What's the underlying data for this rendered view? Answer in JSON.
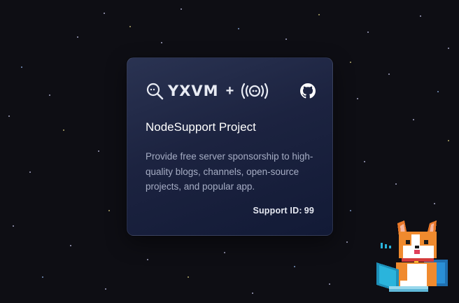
{
  "card": {
    "brand_text": "YXVM",
    "plus": "+",
    "title": "NodeSupport Project",
    "description": "Provide free server sponsorship to high-quality blogs, channels, open-source projects, and popular app.",
    "support_label": "Support ID:",
    "support_id": "99"
  },
  "icons": [
    "magnifier-logo-icon",
    "radio-broadcast-icon",
    "github-icon",
    "corgi-mascot"
  ],
  "colors": {
    "background": "#0e0e14",
    "card_top": "#2a3352",
    "card_bottom": "#121a36",
    "title": "#ffffff",
    "description": "#a6adc4"
  }
}
